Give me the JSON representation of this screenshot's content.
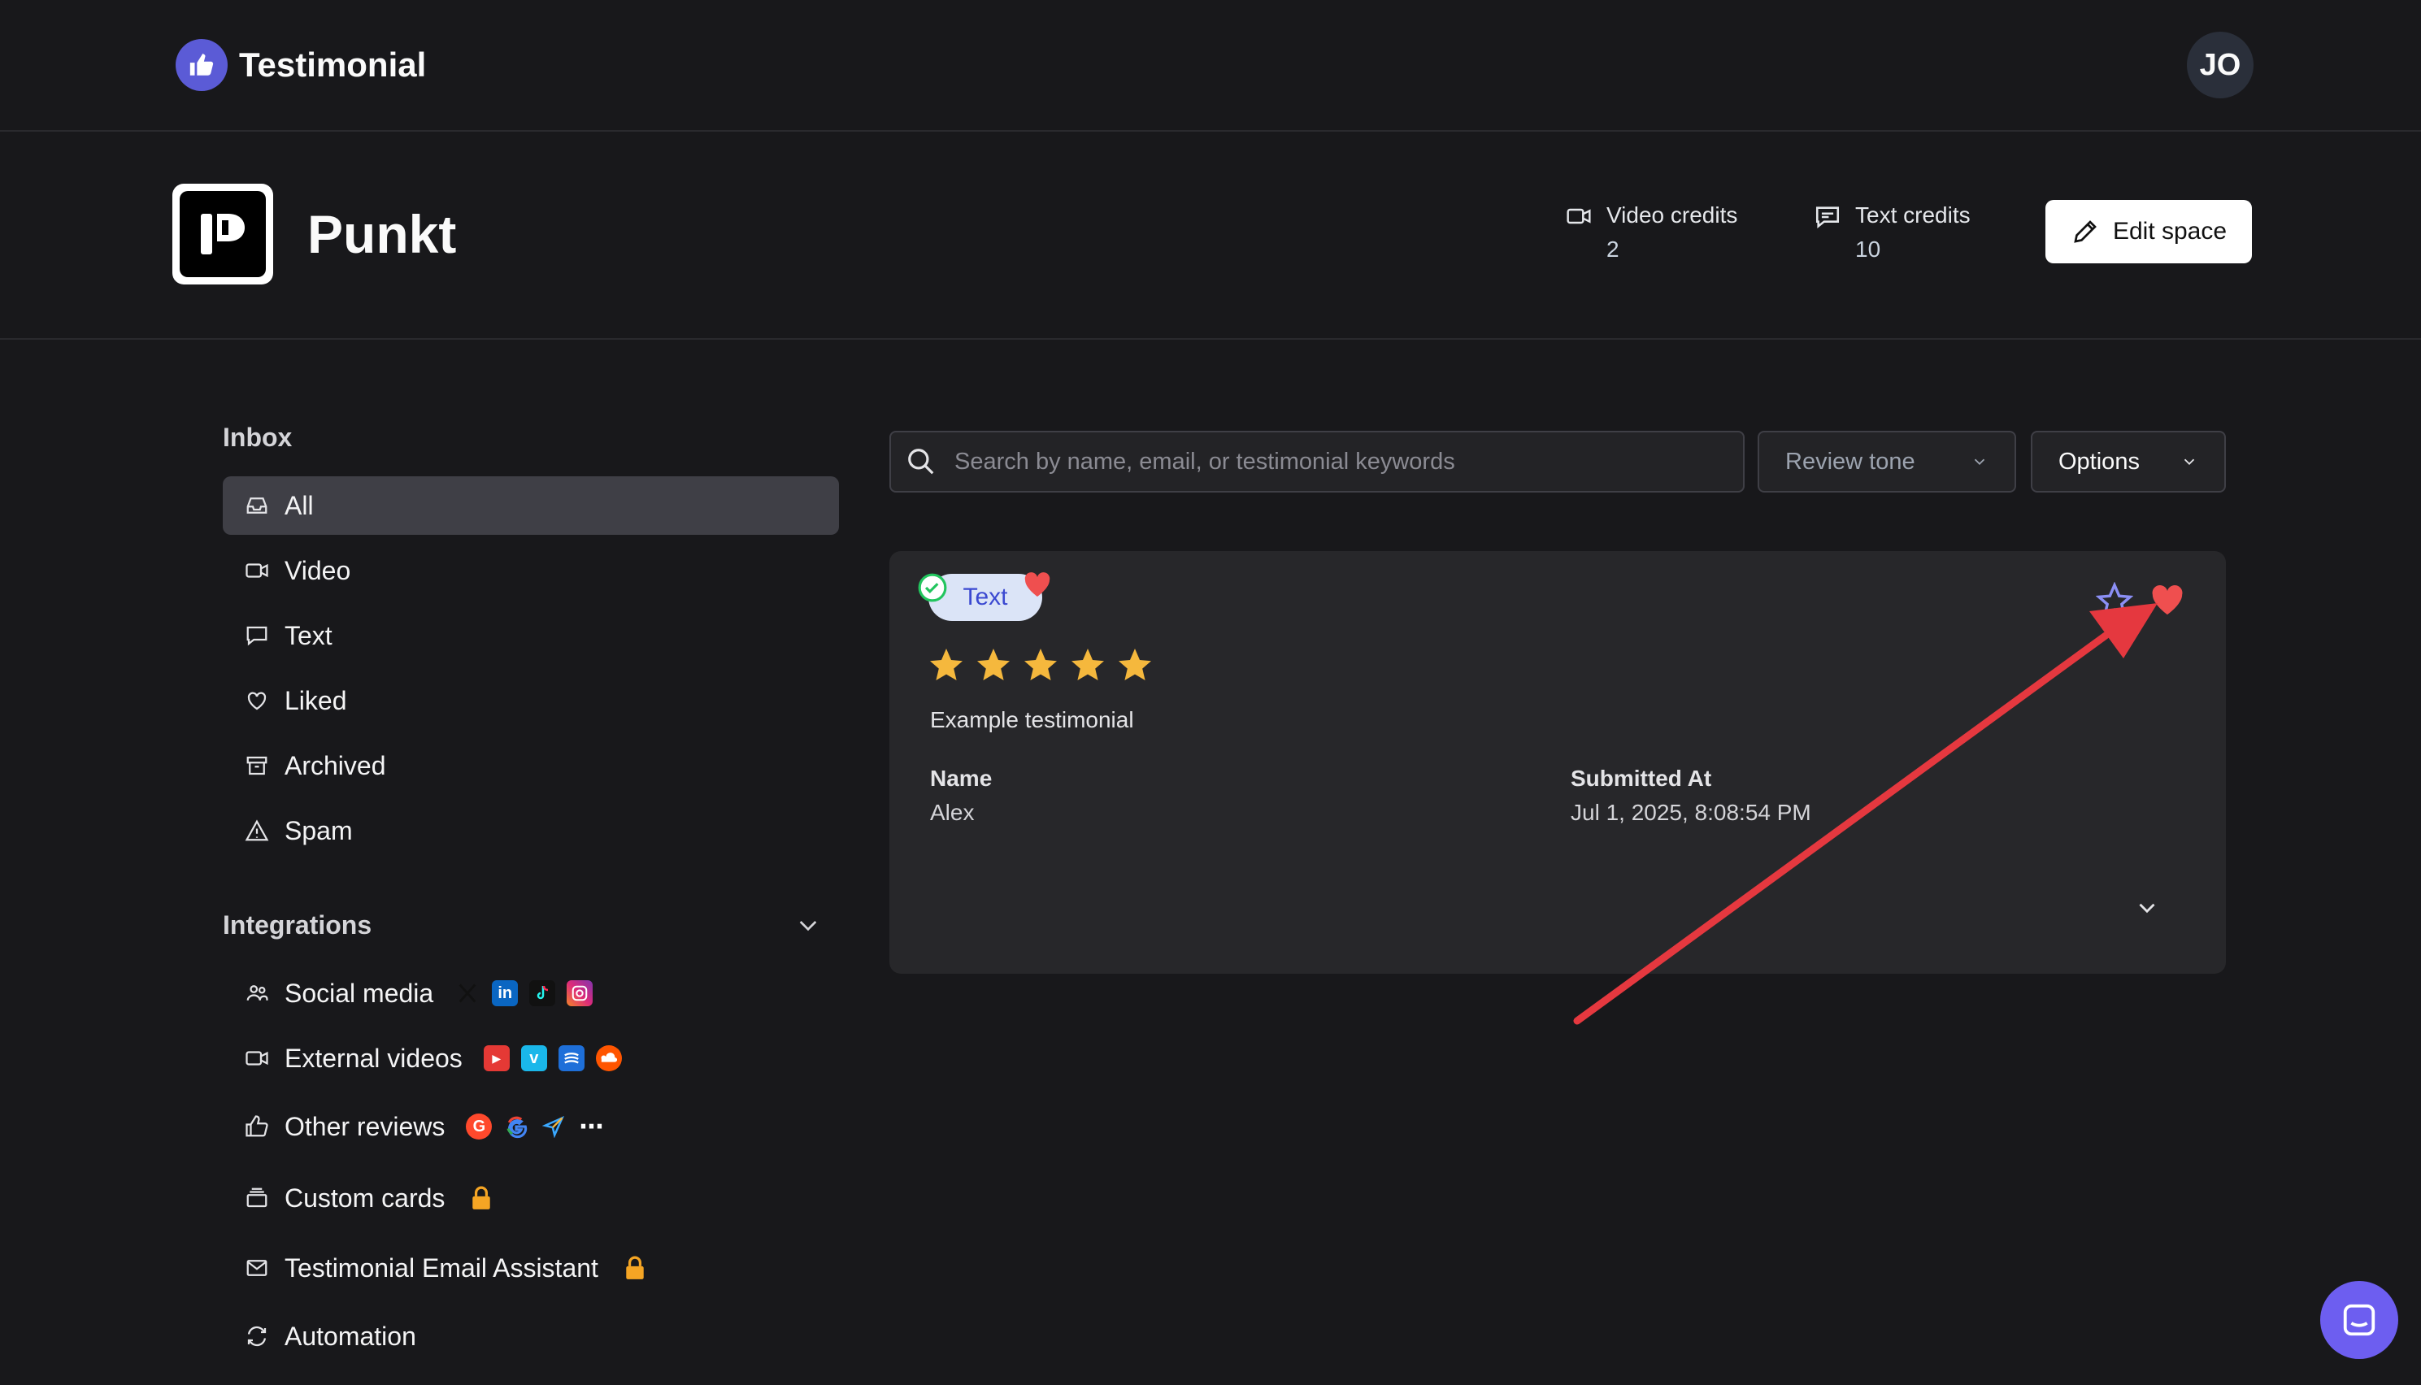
{
  "app": {
    "brand_name": "Testimonial",
    "user_initials": "JO"
  },
  "space": {
    "name": "Punkt",
    "video_credits_label": "Video credits",
    "video_credits_value": "2",
    "text_credits_label": "Text credits",
    "text_credits_value": "10",
    "edit_label": "Edit space"
  },
  "sidebar": {
    "inbox_title": "Inbox",
    "inbox_items": [
      {
        "label": "All",
        "icon": "inbox-icon",
        "active": true
      },
      {
        "label": "Video",
        "icon": "video-icon"
      },
      {
        "label": "Text",
        "icon": "message-icon"
      },
      {
        "label": "Liked",
        "icon": "heart-icon"
      },
      {
        "label": "Archived",
        "icon": "archive-icon"
      },
      {
        "label": "Spam",
        "icon": "warning-icon"
      }
    ],
    "integrations_title": "Integrations",
    "integration_items": [
      {
        "label": "Social media",
        "icon": "users-icon",
        "brands": [
          "x-icon",
          "linkedin-icon",
          "tiktok-icon",
          "instagram-icon"
        ]
      },
      {
        "label": "External videos",
        "icon": "video-icon",
        "brands": [
          "youtube-icon",
          "vimeo-icon",
          "stream-icon",
          "soundcloud-icon"
        ]
      },
      {
        "label": "Other reviews",
        "icon": "thumbs-up-icon",
        "brands": [
          "g2-icon",
          "google-icon",
          "send-icon",
          "more-icon"
        ]
      },
      {
        "label": "Custom cards",
        "icon": "cards-icon",
        "locked": true
      },
      {
        "label": "Testimonial Email Assistant",
        "icon": "mail-icon",
        "locked": true
      },
      {
        "label": "Automation",
        "icon": "refresh-icon"
      }
    ]
  },
  "toolbar": {
    "search_placeholder": "Search by name, email, or testimonial keywords",
    "review_tone_label": "Review tone",
    "options_label": "Options"
  },
  "testimonial": {
    "type_label": "Text",
    "rating": 5,
    "text": "Example testimonial",
    "name_label": "Name",
    "name_value": "Alex",
    "submitted_label": "Submitted At",
    "submitted_value": "Jul 1, 2025, 8:08:54 PM"
  },
  "colors": {
    "background": "#18181b",
    "card": "#27272a",
    "accent": "#5b5bd6",
    "star": "#f5b83d",
    "heart": "#ef4f4f",
    "lock": "#f5a524",
    "annotation_arrow": "#e5383f"
  }
}
